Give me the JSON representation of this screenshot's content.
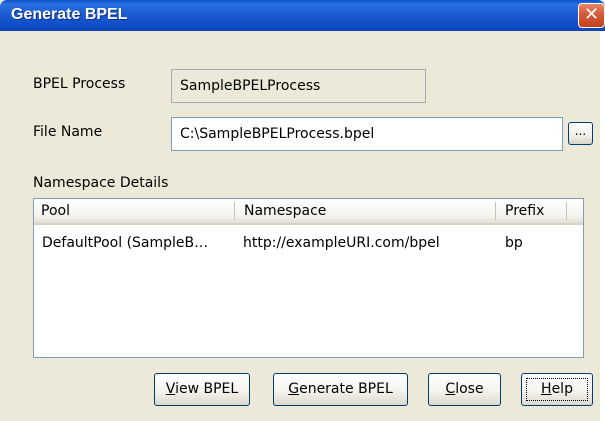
{
  "window": {
    "title": "Generate BPEL",
    "close_glyph": "✕"
  },
  "form": {
    "process_label": "BPEL Process",
    "process_value": "SampleBPELProcess",
    "file_label": "File Name",
    "file_value": "C:\\SampleBPELProcess.bpel",
    "browse_label": "..."
  },
  "namespace": {
    "section_label": "Namespace Details",
    "columns": [
      "Pool",
      "Namespace",
      "Prefix"
    ],
    "rows": [
      {
        "pool": "DefaultPool (SampleB…",
        "namespace": "http://exampleURI.com/bpel",
        "prefix": "bp"
      }
    ]
  },
  "buttons": {
    "view": {
      "mnemonic": "V",
      "rest": "iew BPEL"
    },
    "generate": {
      "mnemonic": "G",
      "rest": "enerate BPEL"
    },
    "close": {
      "mnemonic": "C",
      "rest": "lose"
    },
    "help": {
      "mnemonic": "H",
      "rest": "elp"
    }
  }
}
